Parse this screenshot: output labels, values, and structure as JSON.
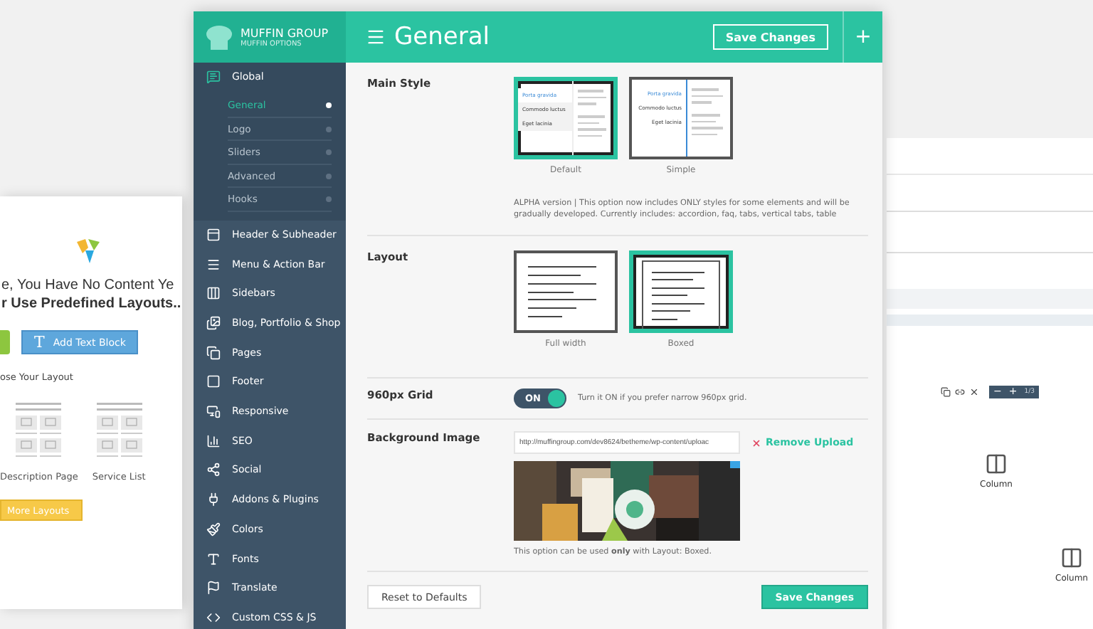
{
  "left_panel": {
    "heading_lines": [
      "e, You Have No Content Ye",
      "r Use Predefined Layouts.."
    ],
    "add_text_button": {
      "icon": "T",
      "label": "Add Text Block"
    },
    "section_label": "ose Your Layout",
    "layouts": [
      {
        "label": "Description Page"
      },
      {
        "label": "Service List"
      }
    ],
    "more_button": "More Layouts"
  },
  "window": {
    "brand": "MUFFIN GROUP",
    "brand_sub": "MUFFIN OPTIONS",
    "title": "General",
    "save_button": "Save Changes",
    "add_button": "+"
  },
  "sidebar": {
    "groups": [
      {
        "label": "Global",
        "expanded": true,
        "children": [
          {
            "label": "General",
            "selected": true
          },
          {
            "label": "Logo",
            "selected": false
          },
          {
            "label": "Sliders",
            "selected": false
          },
          {
            "label": "Advanced",
            "selected": false
          },
          {
            "label": "Hooks",
            "selected": false
          }
        ]
      },
      {
        "label": "Header & Subheader",
        "expanded": false
      },
      {
        "label": "Menu & Action Bar",
        "expanded": false
      },
      {
        "label": "Sidebars",
        "expanded": false
      },
      {
        "label": "Blog, Portfolio & Shop",
        "expanded": false
      },
      {
        "label": "Pages",
        "expanded": false
      },
      {
        "label": "Footer",
        "expanded": false
      },
      {
        "label": "Responsive",
        "expanded": false
      },
      {
        "label": "SEO",
        "expanded": false
      },
      {
        "label": "Social",
        "expanded": false
      },
      {
        "label": "Addons & Plugins",
        "expanded": false
      },
      {
        "label": "Colors",
        "expanded": false
      },
      {
        "label": "Fonts",
        "expanded": false
      },
      {
        "label": "Translate",
        "expanded": false
      },
      {
        "label": "Custom CSS & JS",
        "expanded": false
      }
    ]
  },
  "settings": [
    {
      "kind": "style",
      "label": "Main Style",
      "options": [
        {
          "caption": "Default",
          "selected": true,
          "tabs": [
            "Porta gravida",
            "Commodo luctus",
            "Eget lacinia"
          ]
        },
        {
          "caption": "Simple",
          "selected": false,
          "tabs": [
            "Porta gravida",
            "Commodo luctus",
            "Eget lacinia"
          ]
        }
      ],
      "description": "ALPHA version | This option now includes ONLY styles for some elements and will be gradually developed.  Currently includes: accordion, faq, tabs, vertical tabs, table"
    },
    {
      "kind": "layout",
      "label": "Layout",
      "options": [
        {
          "caption": "Full width",
          "selected": false
        },
        {
          "caption": "Boxed",
          "selected": true
        }
      ]
    },
    {
      "kind": "toggle",
      "label": "960px Grid",
      "on": true,
      "toggle_text": "ON",
      "description": "Turn it ON if you prefer narrow 960px grid."
    },
    {
      "label": "Background Image",
      "value": "http://muffingroup.com/dev8624/betheme/wp-content/uploac",
      "remove_link": "Remove Upload",
      "description": "This option can be used **only** with Layout: Boxed."
    }
  ],
  "footer": {
    "reset_button": "Reset to Defaults",
    "save_button": "Save Changes"
  },
  "right_panel": {
    "pager": {
      "minus": "−",
      "plus": "+",
      "count": "1/3"
    },
    "items": [
      {
        "label": "Column"
      },
      {
        "label": "Column"
      }
    ]
  }
}
